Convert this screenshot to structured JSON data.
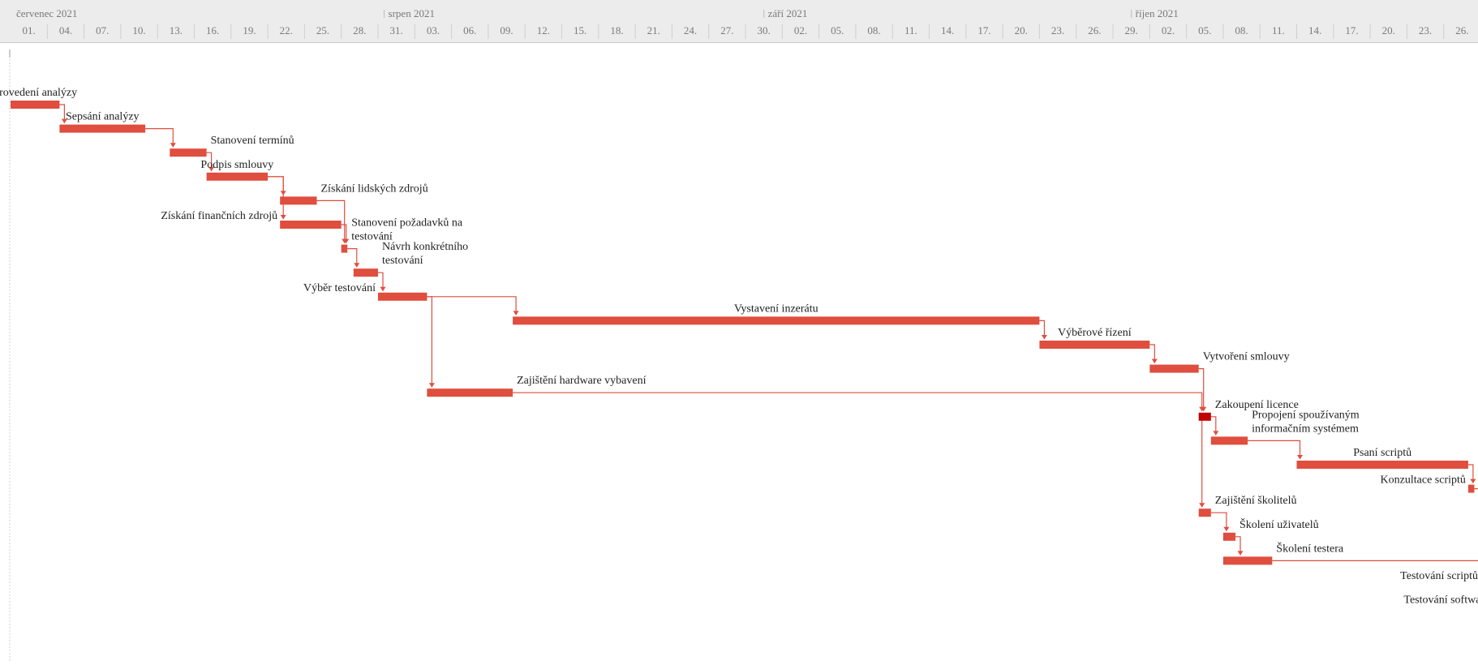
{
  "chart_data": {
    "type": "gantt",
    "timeline": {
      "months": [
        {
          "label": "červenec 2021",
          "start": "2021-07-01"
        },
        {
          "label": "srpen 2021",
          "start": "2021-08-01"
        },
        {
          "label": "září 2021",
          "start": "2021-09-01"
        },
        {
          "label": "říjen 2021",
          "start": "2021-10-01"
        }
      ],
      "ticks": [
        {
          "label": "01.",
          "date": "2021-07-01"
        },
        {
          "label": "04.",
          "date": "2021-07-04"
        },
        {
          "label": "07.",
          "date": "2021-07-07"
        },
        {
          "label": "10.",
          "date": "2021-07-10"
        },
        {
          "label": "13.",
          "date": "2021-07-13"
        },
        {
          "label": "16.",
          "date": "2021-07-16"
        },
        {
          "label": "19.",
          "date": "2021-07-19"
        },
        {
          "label": "22.",
          "date": "2021-07-22"
        },
        {
          "label": "25.",
          "date": "2021-07-25"
        },
        {
          "label": "28.",
          "date": "2021-07-28"
        },
        {
          "label": "31.",
          "date": "2021-07-31"
        },
        {
          "label": "03.",
          "date": "2021-08-03"
        },
        {
          "label": "06.",
          "date": "2021-08-06"
        },
        {
          "label": "09.",
          "date": "2021-08-09"
        },
        {
          "label": "12.",
          "date": "2021-08-12"
        },
        {
          "label": "15.",
          "date": "2021-08-15"
        },
        {
          "label": "18.",
          "date": "2021-08-18"
        },
        {
          "label": "21.",
          "date": "2021-08-21"
        },
        {
          "label": "24.",
          "date": "2021-08-24"
        },
        {
          "label": "27.",
          "date": "2021-08-27"
        },
        {
          "label": "30.",
          "date": "2021-08-30"
        },
        {
          "label": "02.",
          "date": "2021-09-02"
        },
        {
          "label": "05.",
          "date": "2021-09-05"
        },
        {
          "label": "08.",
          "date": "2021-09-08"
        },
        {
          "label": "11.",
          "date": "2021-09-11"
        },
        {
          "label": "14.",
          "date": "2021-09-14"
        },
        {
          "label": "17.",
          "date": "2021-09-17"
        },
        {
          "label": "20.",
          "date": "2021-09-20"
        },
        {
          "label": "23.",
          "date": "2021-09-23"
        },
        {
          "label": "26.",
          "date": "2021-09-26"
        },
        {
          "label": "29.",
          "date": "2021-09-29"
        },
        {
          "label": "02.",
          "date": "2021-10-02"
        },
        {
          "label": "05.",
          "date": "2021-10-05"
        },
        {
          "label": "08.",
          "date": "2021-10-08"
        },
        {
          "label": "11.",
          "date": "2021-10-11"
        },
        {
          "label": "14.",
          "date": "2021-10-14"
        },
        {
          "label": "17.",
          "date": "2021-10-17"
        },
        {
          "label": "20.",
          "date": "2021-10-20"
        },
        {
          "label": "23.",
          "date": "2021-10-23"
        },
        {
          "label": "26.",
          "date": "2021-10-26"
        }
      ]
    },
    "tasks": [
      {
        "id": "t1",
        "name": [
          "Provedení analýzy"
        ],
        "label_side": "above",
        "start": "2021-07-01",
        "end": "2021-07-05"
      },
      {
        "id": "t2",
        "name": [
          "Sepsání analýzy"
        ],
        "label_side": "above",
        "start": "2021-07-05",
        "end": "2021-07-12"
      },
      {
        "id": "t3",
        "name": [
          "Stanovení termínů"
        ],
        "label_side": "right",
        "start": "2021-07-14",
        "end": "2021-07-17"
      },
      {
        "id": "t4",
        "name": [
          "Podpis smlouvy"
        ],
        "label_side": "above",
        "start": "2021-07-17",
        "end": "2021-07-22"
      },
      {
        "id": "t5",
        "name": [
          "Získání lidských zdrojů"
        ],
        "label_side": "right",
        "start": "2021-07-23",
        "end": "2021-07-26"
      },
      {
        "id": "t6",
        "name": [
          "Získání finančních zdrojů"
        ],
        "label_side": "left",
        "start": "2021-07-23",
        "end": "2021-07-28"
      },
      {
        "id": "t7",
        "name": [
          "Stanovení požadavků na",
          "testování"
        ],
        "label_side": "right",
        "start": "2021-07-28",
        "end": "2021-07-28"
      },
      {
        "id": "t8",
        "name": [
          "Návrh konkrétního",
          "testování"
        ],
        "label_side": "right",
        "start": "2021-07-29",
        "end": "2021-07-31"
      },
      {
        "id": "t9",
        "name": [
          "Výběr testování"
        ],
        "label_side": "left",
        "start": "2021-07-31",
        "end": "2021-08-04"
      },
      {
        "id": "t10",
        "name": [
          "Vystavení inzerátu"
        ],
        "label_side": "above",
        "start": "2021-08-11",
        "end": "2021-09-23"
      },
      {
        "id": "t11",
        "name": [
          "Výběrové řízení"
        ],
        "label_side": "above",
        "start": "2021-09-23",
        "end": "2021-10-02"
      },
      {
        "id": "t12",
        "name": [
          "Vytvoření smlouvy"
        ],
        "label_side": "right",
        "start": "2021-10-02",
        "end": "2021-10-06"
      },
      {
        "id": "t13",
        "name": [
          "Zajištění hardware vybavení"
        ],
        "label_side": "right",
        "start": "2021-08-04",
        "end": "2021-08-11"
      },
      {
        "id": "t14",
        "name": [
          "Zakoupení licence"
        ],
        "label_side": "right",
        "start": "2021-10-06",
        "end": "2021-10-07",
        "color": "#c00000"
      },
      {
        "id": "t15",
        "name": [
          "Propojení spoužívaným",
          "informačním systémem"
        ],
        "label_side": "right",
        "start": "2021-10-07",
        "end": "2021-10-10"
      },
      {
        "id": "t16",
        "name": [
          "Psaní scriptů"
        ],
        "label_side": "above",
        "start": "2021-10-14",
        "end": "2021-10-28"
      },
      {
        "id": "t17",
        "name": [
          "Konzultace scriptů"
        ],
        "label_side": "left",
        "start": "2021-10-28",
        "end": "2021-10-28"
      },
      {
        "id": "t18",
        "name": [
          "Zajištění školitelů"
        ],
        "label_side": "right",
        "start": "2021-10-06",
        "end": "2021-10-07"
      },
      {
        "id": "t19",
        "name": [
          "Školení uživatelů"
        ],
        "label_side": "right",
        "start": "2021-10-08",
        "end": "2021-10-09"
      },
      {
        "id": "t20",
        "name": [
          "Školení testera"
        ],
        "label_side": "right",
        "start": "2021-10-08",
        "end": "2021-10-12"
      },
      {
        "id": "t21",
        "name": [
          "Testování scriptů"
        ],
        "label_side": "left",
        "start": "2021-10-29",
        "end": "2021-10-30"
      },
      {
        "id": "t22",
        "name": [
          "Testování softwaru"
        ],
        "label_side": "left",
        "start": "2021-10-30",
        "end": "2021-10-31"
      }
    ],
    "dependencies": [
      [
        "t1",
        "t2"
      ],
      [
        "t2",
        "t3"
      ],
      [
        "t3",
        "t4"
      ],
      [
        "t4",
        "t5"
      ],
      [
        "t4",
        "t6"
      ],
      [
        "t5",
        "t7"
      ],
      [
        "t6",
        "t7"
      ],
      [
        "t7",
        "t8"
      ],
      [
        "t8",
        "t9"
      ],
      [
        "t9",
        "t10"
      ],
      [
        "t9",
        "t13"
      ],
      [
        "t10",
        "t11"
      ],
      [
        "t11",
        "t12"
      ],
      [
        "t12",
        "t14"
      ],
      [
        "t13",
        "t14"
      ],
      [
        "t14",
        "t15"
      ],
      [
        "t15",
        "t16"
      ],
      [
        "t16",
        "t17"
      ],
      [
        "t14",
        "t18"
      ],
      [
        "t18",
        "t19"
      ],
      [
        "t19",
        "t20"
      ],
      [
        "t17",
        "t21"
      ],
      [
        "t20",
        "t21"
      ],
      [
        "t21",
        "t22"
      ]
    ],
    "colors": {
      "bar": "#df4e3e",
      "bar_dark": "#c00000",
      "link": "#df4e3e",
      "header_bg": "#ececec",
      "tick_text": "#7a7a7a"
    }
  }
}
